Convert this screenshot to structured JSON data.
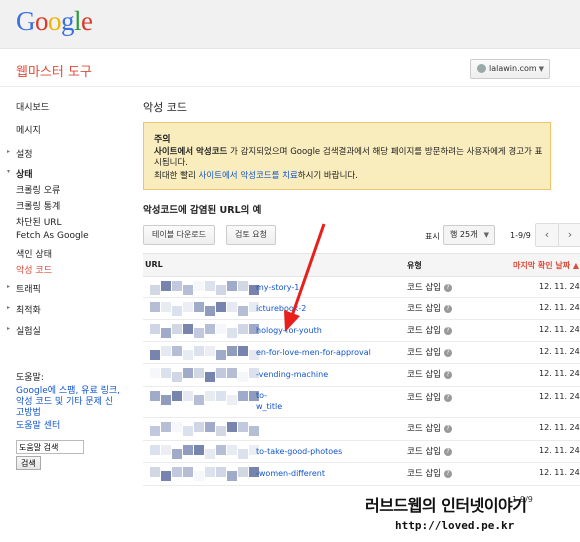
{
  "header": {
    "logo_letters": [
      "G",
      "o",
      "o",
      "g",
      "l",
      "e"
    ],
    "app_title": "웹마스터 도구",
    "site_selector": "lalawin.com"
  },
  "sidebar": {
    "items": [
      {
        "label": "대시보드",
        "arrow": ""
      },
      {
        "label": "메시지",
        "arrow": ""
      },
      {
        "label": "설정",
        "arrow": "▸"
      },
      {
        "label": "상태",
        "arrow": "▾"
      },
      {
        "label": "크롤링 오류",
        "arrow": ""
      },
      {
        "label": "크롤링 통계",
        "arrow": ""
      },
      {
        "label": "차단된 URL",
        "arrow": ""
      },
      {
        "label": "Fetch As Google",
        "arrow": ""
      },
      {
        "label": "색인 상태",
        "arrow": ""
      },
      {
        "label": "악성 코드",
        "arrow": ""
      },
      {
        "label": "트래픽",
        "arrow": "▸"
      },
      {
        "label": "최적화",
        "arrow": "▸"
      },
      {
        "label": "실험실",
        "arrow": "▸"
      }
    ],
    "help": {
      "heading": "도움말:",
      "link1": "Google에 스팸, 유료 링크, 악성 코드 및 기타 문제 신고방법",
      "link2": "도움말 센터",
      "search_value": "도움말 검색",
      "search_button": "검색"
    }
  },
  "main": {
    "title": "악성 코드",
    "warning": {
      "heading": "주의",
      "line1_bold": "사이트에서 악성코드",
      "line1_rest": "가 감지되었으며 Google 검색결과에서 해당 페이지를 방문하려는 사용자에게 경고가 표시됩니다.",
      "line2_pre": "최대한 빨리 ",
      "line2_link": "사이트에서 악성코드를 치료",
      "line2_post": "하시기 바랍니다."
    },
    "section_title": "악성코드에 감염된 URL의 예",
    "download_button": "테이블 다운로드",
    "review_button": "검토 요청",
    "show_label": "표시",
    "rows_select": "행 25개",
    "page_info": "1-9/9",
    "prev_icon": "‹",
    "next_icon": "›",
    "columns": {
      "url": "URL",
      "type": "유형",
      "date": "마지막 확인 날짜 ▲"
    },
    "rows": [
      {
        "url": "my-story-1",
        "type": "코드 삽입",
        "date": "12. 11. 24."
      },
      {
        "url": "icturebook-2",
        "type": "코드 삽입",
        "date": "12. 11. 24."
      },
      {
        "url": "hology-for-youth",
        "type": "코드 삽입",
        "date": "12. 11. 24."
      },
      {
        "url": "en-for-love-men-for-approval",
        "type": "코드 삽입",
        "date": "12. 11. 24."
      },
      {
        "url": "-vending-machine",
        "type": "코드 삽입",
        "date": "12. 11. 24."
      },
      {
        "url": "to-\nw_title",
        "type": "코드 삽입",
        "date": "12. 11. 24."
      },
      {
        "url": "",
        "type": "코드 삽입",
        "date": "12. 11. 24."
      },
      {
        "url": "to-take-good-photoes",
        "type": "코드 삽입",
        "date": "12. 11. 24."
      },
      {
        "url": "-women-different",
        "type": "코드 삽입",
        "date": "12. 11. 24."
      }
    ],
    "bottom_page_info": "1-9/9"
  },
  "watermark": {
    "line1a": "러브드웹의 ",
    "line1b": "인터넷이야기",
    "line2": "http://loved.pe.kr"
  },
  "colors": {
    "accent": "#dd4b39",
    "link": "#1155cc",
    "warning_bg": "#f9edbe",
    "arrow": "#e8201c"
  }
}
